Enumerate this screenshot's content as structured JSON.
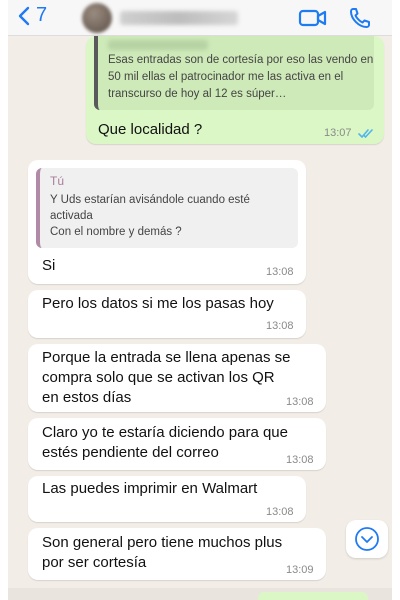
{
  "header": {
    "back_count": "7",
    "icons": {
      "back": "chevron-left-icon",
      "video": "video-camera-icon",
      "call": "phone-icon"
    },
    "accent_color": "#1f7bf2"
  },
  "colors": {
    "outgoing": "#dbf7c6",
    "incoming": "#ffffff",
    "chat_background": "#f2eee7",
    "read_ticks": "#4fb6ec"
  },
  "messages": [
    {
      "direction": "out",
      "quote_text": "Esas entradas son de cortesía por eso las vendo en 50 mil ellas el patrocinador me las activa en el transcurso de hoy al 12 es súper…",
      "text": "Que localidad ?",
      "time": "13:07",
      "status": "read"
    },
    {
      "direction": "in",
      "reply_to": {
        "author": "Tú",
        "text": [
          "Y Uds estarían avisándole cuando esté",
          "activada",
          "Con el nombre y demás ?"
        ]
      },
      "text": "Si",
      "time": "13:08"
    },
    {
      "direction": "in",
      "text": "Pero los datos si me los pasas hoy",
      "time": "13:08"
    },
    {
      "direction": "in",
      "text": [
        "Porque la entrada se llena apenas se",
        "compra solo que se activan los QR",
        "en estos días"
      ],
      "time": "13:08"
    },
    {
      "direction": "in",
      "text": [
        "Claro yo te estaría diciendo para que",
        "estés pendiente del correo"
      ],
      "time": "13:08"
    },
    {
      "direction": "in",
      "text": "Las puedes imprimir en Walmart",
      "time": "13:08"
    },
    {
      "direction": "in",
      "text": [
        "Son general pero tiene muchos plus",
        "por ser cortesía"
      ],
      "time": "13:09"
    }
  ],
  "scroll_button": {
    "icon": "chevron-down-circle-icon"
  }
}
